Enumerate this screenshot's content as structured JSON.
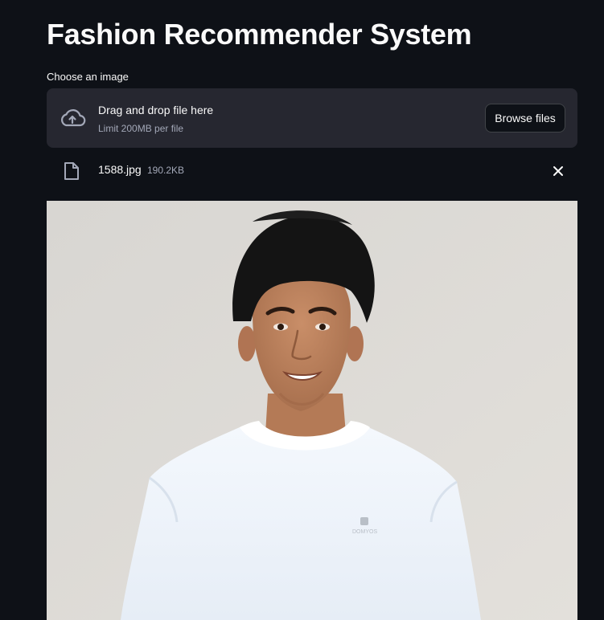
{
  "header": {
    "title": "Fashion Recommender System"
  },
  "uploader": {
    "label": "Choose an image",
    "dropzone_title": "Drag and drop file here",
    "dropzone_limit": "Limit 200MB per file",
    "browse_label": "Browse files",
    "icon": "cloud-upload-icon"
  },
  "uploaded_file": {
    "name": "1588.jpg",
    "size": "190.2KB",
    "icon": "file-icon",
    "remove_icon": "close-icon"
  },
  "preview": {
    "tshirt_logo": "DOMYOS"
  },
  "colors": {
    "background": "#0e1117",
    "dropzone": "#262730",
    "muted_text": "#a3a8b8"
  }
}
